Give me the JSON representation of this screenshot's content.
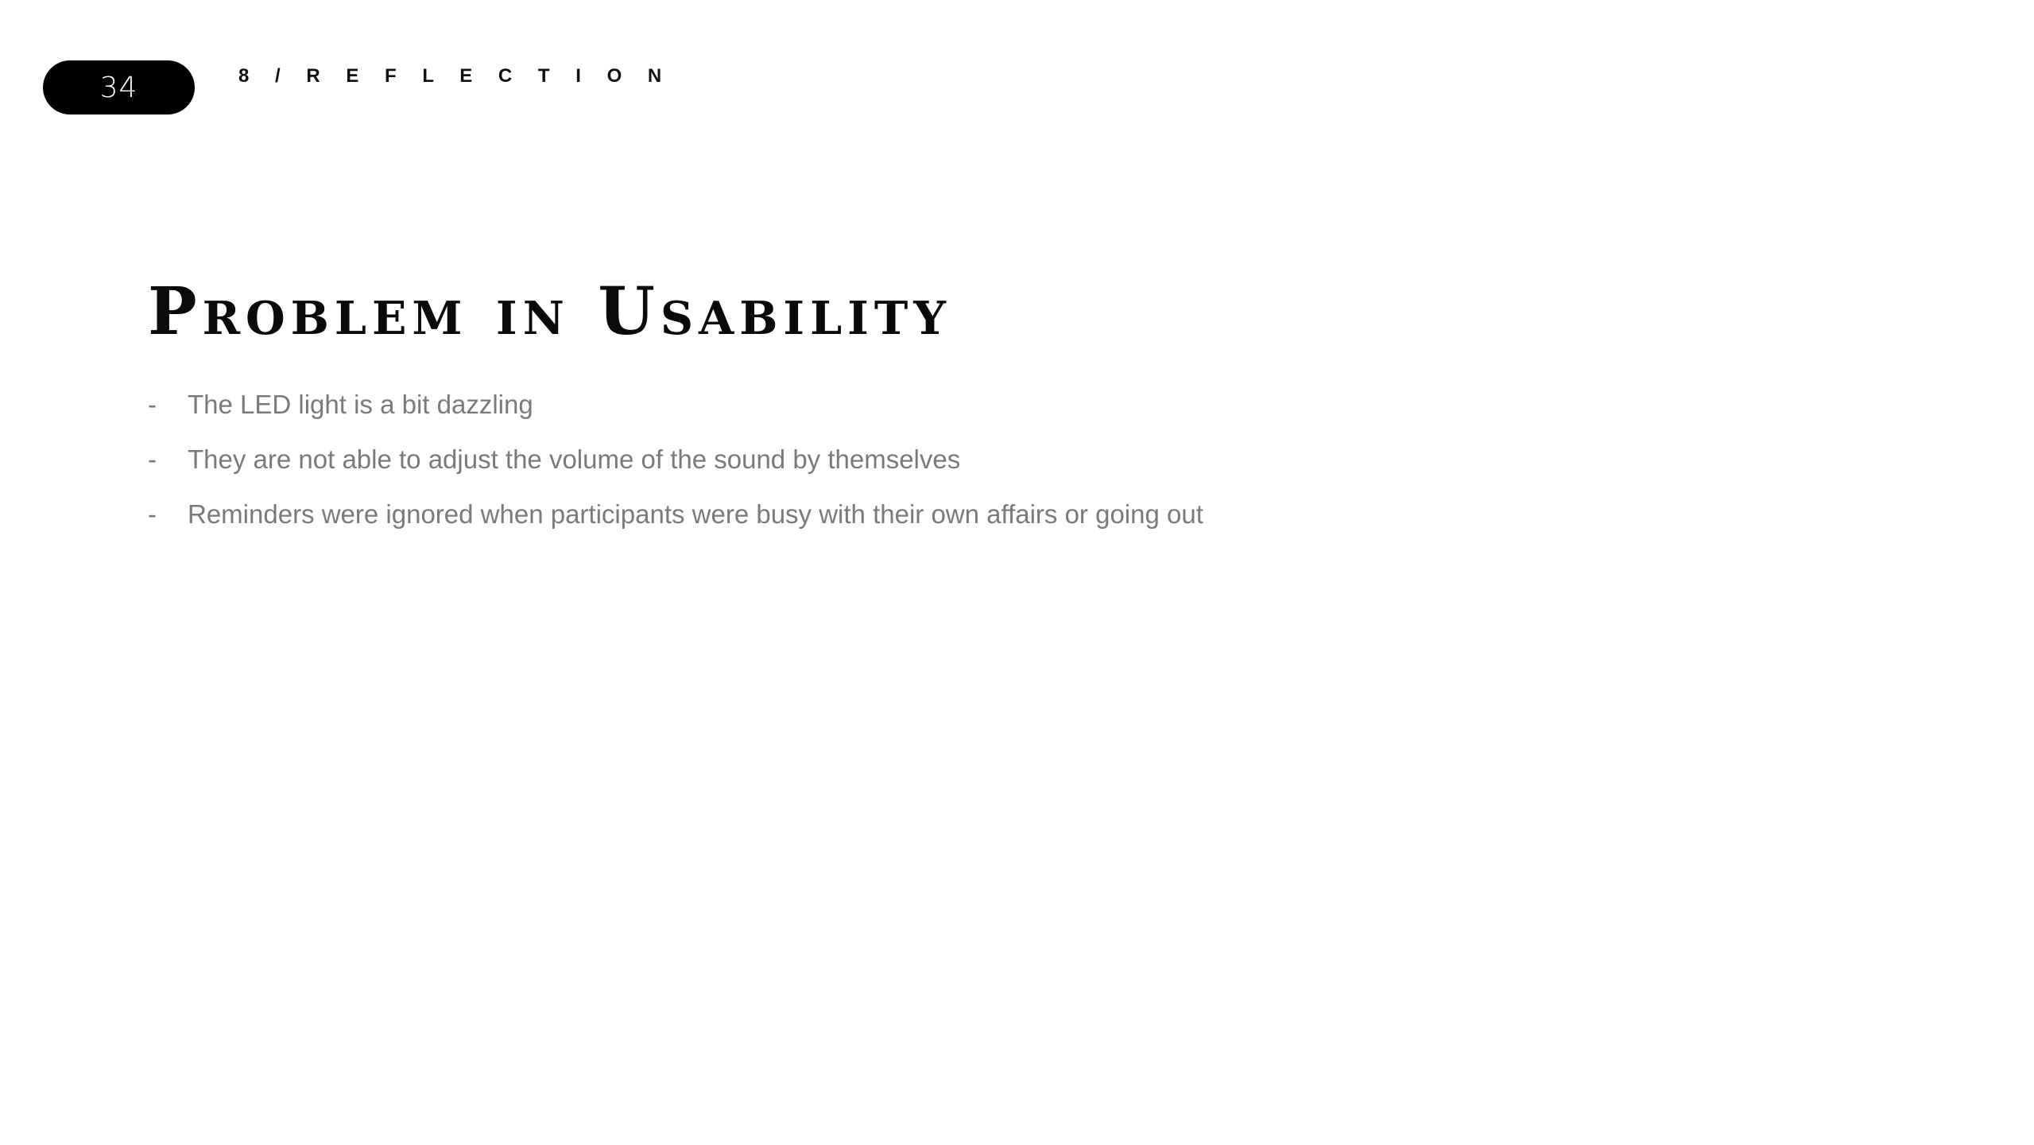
{
  "header": {
    "page_number": "34",
    "section_label": "8 / R E F L E C T I O N"
  },
  "slide": {
    "title": "Problem in Usability",
    "bullet_marker": "-",
    "bullets": [
      "The LED light is a bit dazzling",
      "They are not able to adjust the volume of the sound by themselves",
      "Reminders were ignored when participants were busy with their own affairs or going out"
    ]
  },
  "colors": {
    "pill_background": "#000000",
    "pill_text": "#ffffff",
    "title_text": "#0a0a0a",
    "bullet_text": "#7a7a7a"
  }
}
